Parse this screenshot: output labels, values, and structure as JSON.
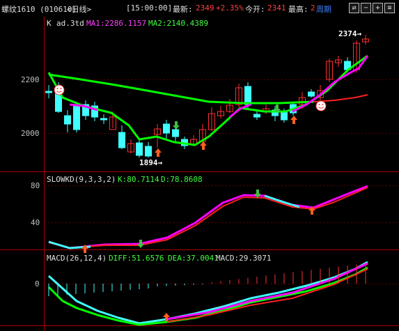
{
  "title": {
    "instrument": "螺纹1610 (010610)",
    "period": "<日线>",
    "time": "[15:00:00]",
    "latest_label": "最新:",
    "latest_value": "2349",
    "change_pct": "+2.35%",
    "open_label": "今开:",
    "open_value": "2341",
    "high_label": "最高:",
    "high_value": "2",
    "cycle_label": "周期"
  },
  "main_panel": {
    "legend_k": "K",
    "legend_ad": "ad.3td",
    "ma1": "MA1:2286.1157",
    "ma2": "MA2:2140.4389",
    "y_ticks": [
      "2200",
      "2000"
    ],
    "max_label": "2374→",
    "min_label": "1894→"
  },
  "kd_panel": {
    "name": "SLOWKD(9,3,3,2)",
    "k": "K:80.7114",
    "d": "D:78.8608",
    "y_ticks": [
      "80",
      "40"
    ]
  },
  "macd_panel": {
    "name": "MACD(26,12,4)",
    "diff": "DIFF:51.6576",
    "dea": "DEA:37.0041",
    "macd": "MACD:29.3071",
    "y_ticks": [
      "0"
    ]
  },
  "colors": {
    "up": "#ff3030",
    "down": "#40ffff",
    "ma1": "#ff00ff",
    "ma2": "#00ff00",
    "ma_red": "#ff2020",
    "axis": "#b00000"
  },
  "icons": [
    "smiley-icon",
    "buy-arrow-icon",
    "sell-arrow-icon"
  ]
}
